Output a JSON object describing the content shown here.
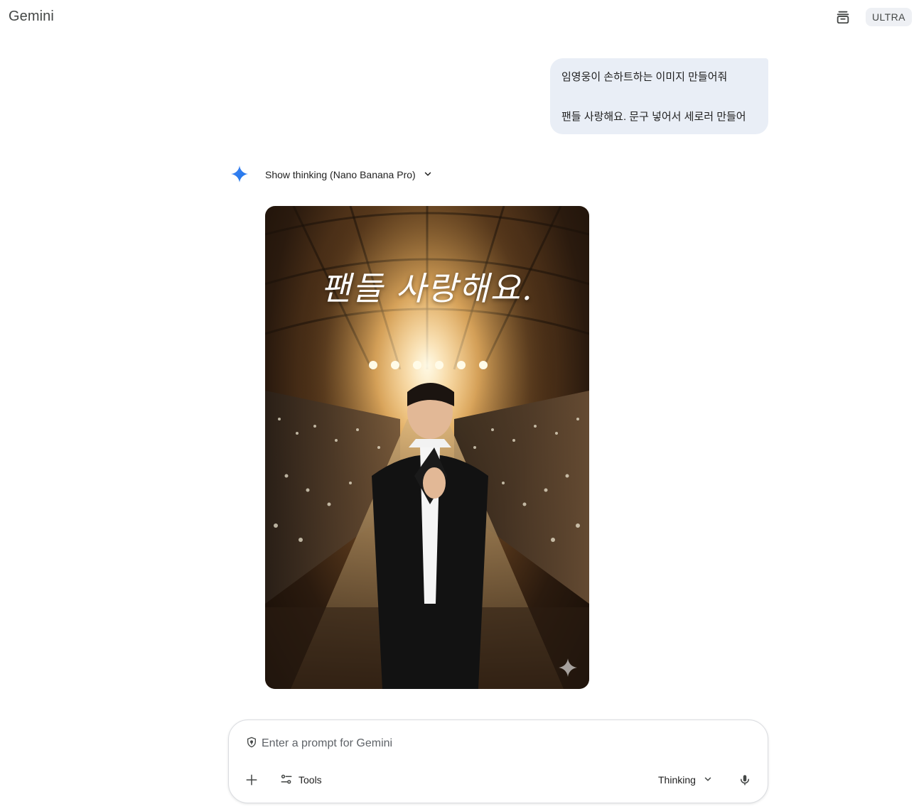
{
  "header": {
    "app_title": "Gemini",
    "plan_badge": "ULTRA",
    "icons": {
      "temp_chat": "incognito-chat-icon"
    }
  },
  "conversation": {
    "user_message": {
      "line1": "임영웅이 손하트하는 이미지 만들어줘",
      "line2": "팬들 사랑해요. 문구 넣어서 세로러 만들어"
    },
    "response": {
      "model_icon": "gemini-spark-icon",
      "thinking_label": "Show thinking (Nano Banana Pro)",
      "image": {
        "caption_text": "팬들 사랑해요.",
        "watermark_icon": "gemini-spark-watermark"
      }
    }
  },
  "composer": {
    "placeholder": "Enter a prompt for Gemini",
    "tools_label": "Tools",
    "mode_label": "Thinking",
    "icons": {
      "shield": "shield-icon",
      "add": "plus-icon",
      "tools": "tools-icon",
      "mode_dropdown": "chevron-down-icon",
      "mic": "microphone-icon"
    }
  },
  "colors": {
    "spark_gradient_start": "#4285f4",
    "spark_gradient_end": "#1a73e8",
    "user_bubble_bg": "#e9eef6",
    "badge_bg": "#eef0f4"
  }
}
